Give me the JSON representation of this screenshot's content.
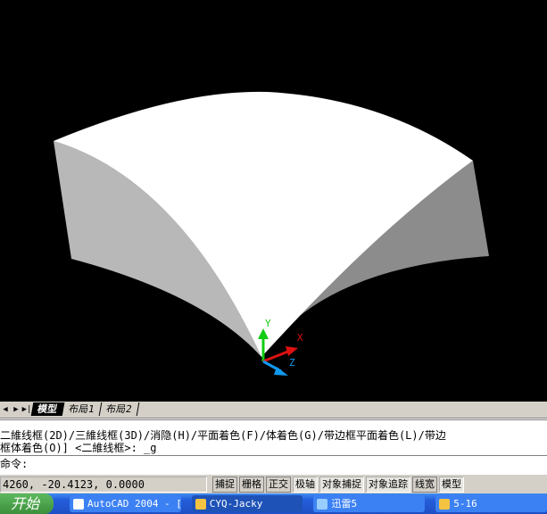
{
  "tabs": {
    "items": [
      "模型",
      "布局1",
      "布局2"
    ]
  },
  "command": {
    "line1": "二維线框(2D)/三維线框(3D)/消隐(H)/平面着色(F)/体着色(G)/带边框平面着色(L)/带边",
    "line2": "框体着色(O)] <二維线框>: _g",
    "prompt": "命令:"
  },
  "status": {
    "coords": "4260,  -20.4123, 0.0000",
    "buttons": [
      {
        "label": "捕捉",
        "on": false
      },
      {
        "label": "栅格",
        "on": false
      },
      {
        "label": "正交",
        "on": false
      },
      {
        "label": "极轴",
        "on": true
      },
      {
        "label": "对象捕捉",
        "on": true
      },
      {
        "label": "对象追踪",
        "on": true
      },
      {
        "label": "线宽",
        "on": false
      },
      {
        "label": "模型",
        "on": true
      }
    ]
  },
  "ucs": {
    "x": "X",
    "y": "Y",
    "z": "Z"
  },
  "taskbar": {
    "start": "开始",
    "items": [
      "AutoCAD 2004 - [...",
      "CYQ-Jacky",
      "迅雷5",
      "5-16"
    ]
  }
}
